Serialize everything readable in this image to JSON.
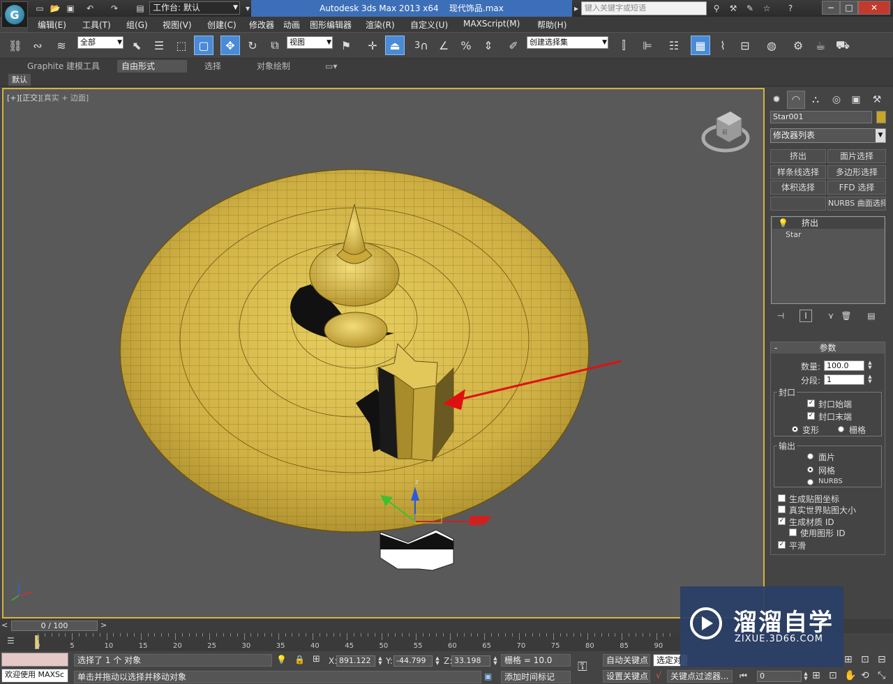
{
  "titlebar": {
    "workspace": "工作台: 默认",
    "app_title": "Autodesk 3ds Max  2013 x64",
    "file_name": "现代饰品.max",
    "search_placeholder": "键入关键字或短语"
  },
  "menu": [
    "编辑(E)",
    "工具(T)",
    "组(G)",
    "视图(V)",
    "创建(C)",
    "修改器",
    "动画",
    "图形编辑器",
    "渲染(R)",
    "自定义(U)",
    "MAXScript(M)",
    "帮助(H)"
  ],
  "toolbar": {
    "selection_filter": "全部",
    "reference_coord": "视图",
    "named_selection": "创建选择集",
    "snap_label": "3"
  },
  "ribbon": {
    "tabs": [
      "Graphite 建模工具",
      "自由形式",
      "选择",
      "对象绘制"
    ],
    "active_tab": "自由形式",
    "sub_label": "默认"
  },
  "viewport": {
    "label_plus": "[+]",
    "label_view": "[正交]",
    "label_shading": "[真实 + 边面]",
    "viewcube_face": "前"
  },
  "command_panel": {
    "object_name": "Star001",
    "object_color": "#c8a628",
    "modifier_list": "修改器列表",
    "modifier_buttons": [
      "挤出",
      "面片选择",
      "样条线选择",
      "多边形选择",
      "体积选择",
      "FFD 选择",
      "",
      "NURBS 曲面选择"
    ],
    "stack": {
      "top": "挤出",
      "base": "Star"
    },
    "params_title": "参数",
    "amount_label": "数量:",
    "amount_value": "100.0",
    "segments_label": "分段:",
    "segments_value": "1",
    "capping": {
      "title": "封口",
      "cap_start": "封口始端",
      "cap_end": "封口末端",
      "morph": "变形",
      "grid": "栅格"
    },
    "output": {
      "title": "输出",
      "patch": "面片",
      "mesh": "网格",
      "nurbs": "NURBS"
    },
    "options": {
      "gen_map_coords": "生成贴图坐标",
      "real_world": "真实世界贴图大小",
      "gen_mat_ids": "生成材质 ID",
      "use_shape_ids": "使用图形 ID",
      "smooth": "平滑"
    }
  },
  "timeline": {
    "slider": "0 / 100",
    "ticks": [
      "0",
      "5",
      "10",
      "15",
      "20",
      "25",
      "30",
      "35",
      "40",
      "45",
      "50",
      "55",
      "60",
      "65",
      "70",
      "75",
      "80",
      "85",
      "90"
    ]
  },
  "status": {
    "selection": "选择了 1 个 对象",
    "x_label": "X:",
    "x_value": "891.122",
    "y_label": "Y:",
    "y_value": "-44.799",
    "z_label": "Z:",
    "z_value": "33.198",
    "grid": "栅格 = 10.0",
    "auto_key": "自动关键点",
    "selected": "选定对",
    "set_key": "设置关键点",
    "key_filters": "关键点过滤器...",
    "frame": "0",
    "prompt_welcome": "欢迎使用 MAXSc",
    "prompt_hint": "单击并拖动以选择并移动对象",
    "add_time_tag": "添加时间标记"
  },
  "watermark": {
    "brand": "溜溜自学",
    "url": "ZIXUE.3D66.COM"
  }
}
